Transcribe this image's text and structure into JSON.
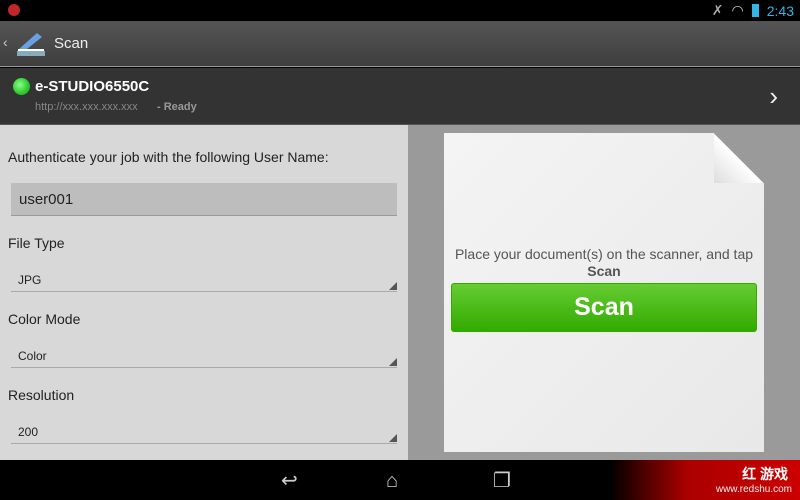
{
  "status_bar": {
    "time": "2:43",
    "icons": [
      "notification-icon",
      "bluetooth-off-icon",
      "wifi-icon",
      "battery-icon"
    ]
  },
  "action_bar": {
    "title": "Scan"
  },
  "device": {
    "name": "e-STUDIO6550C",
    "url": "http://xxx.xxx.xxx.xxx",
    "state": "- Ready",
    "status_color": "#33cc33"
  },
  "form": {
    "auth_label": "Authenticate your job with the following User Name:",
    "username": "user001",
    "file_type": {
      "label": "File Type",
      "value": "JPG"
    },
    "color_mode": {
      "label": "Color Mode",
      "value": "Color"
    },
    "resolution": {
      "label": "Resolution",
      "value": "200"
    }
  },
  "preview": {
    "message": "Place your document(s) on the scanner, and tap",
    "message_bold": "Scan",
    "scan_button": "Scan",
    "accent": "#44aa11"
  },
  "watermark": {
    "brand": "红 游戏",
    "url": "www.redshu.com"
  }
}
